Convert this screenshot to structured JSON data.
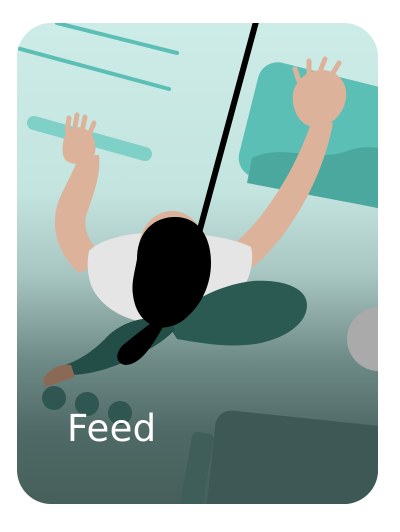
{
  "card": {
    "title": "Feed",
    "illustration": "climber-illustration",
    "colors": {
      "background_top": "#cdece8",
      "background_bottom": "#465f5b",
      "accent_teal": "#5bbfb5",
      "skin": "#dcb39a",
      "shirt": "#e5e5e5",
      "pants": "#2a5a52",
      "hair": "#000000",
      "title_text": "#ffffff"
    }
  }
}
